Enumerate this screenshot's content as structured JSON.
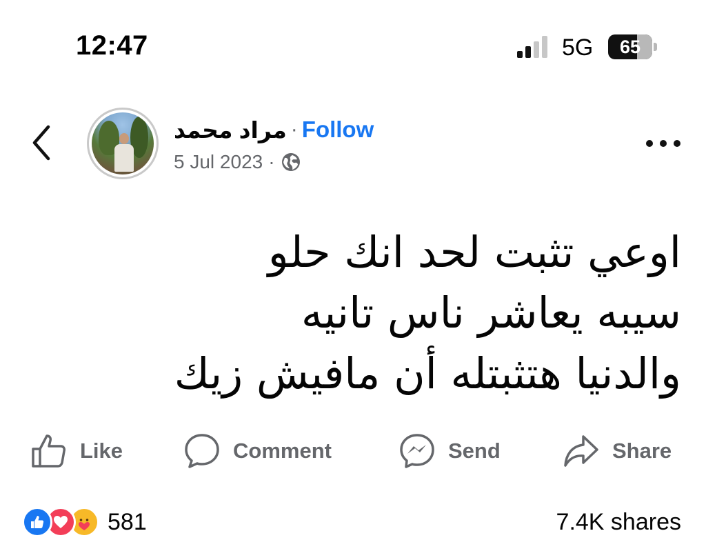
{
  "status_bar": {
    "time": "12:47",
    "network": "5G",
    "battery_percent": "65",
    "battery_level": 0.65,
    "signal_bars_active": 2,
    "signal_bars_total": 4
  },
  "post": {
    "author_name": "مراد محمد",
    "separator": "·",
    "follow_label": "Follow",
    "date": "5 Jul 2023",
    "date_separator": "·",
    "audience_icon": "globe-icon",
    "lines": [
      "اوعي تثبت لحد انك حلو",
      "سيبه يعاشر ناس تانيه",
      "والدنيا هتثبتله أن مافيش زيك"
    ]
  },
  "actions": {
    "like_label": "Like",
    "comment_label": "Comment",
    "send_label": "Send",
    "share_label": "Share"
  },
  "stats": {
    "reactions": [
      "like",
      "love",
      "care"
    ],
    "reaction_count": "581",
    "shares": "7.4K shares"
  },
  "colors": {
    "accent": "#1877f2",
    "muted_text": "#65676b",
    "love": "#f33e58",
    "care": "#f7b928"
  }
}
